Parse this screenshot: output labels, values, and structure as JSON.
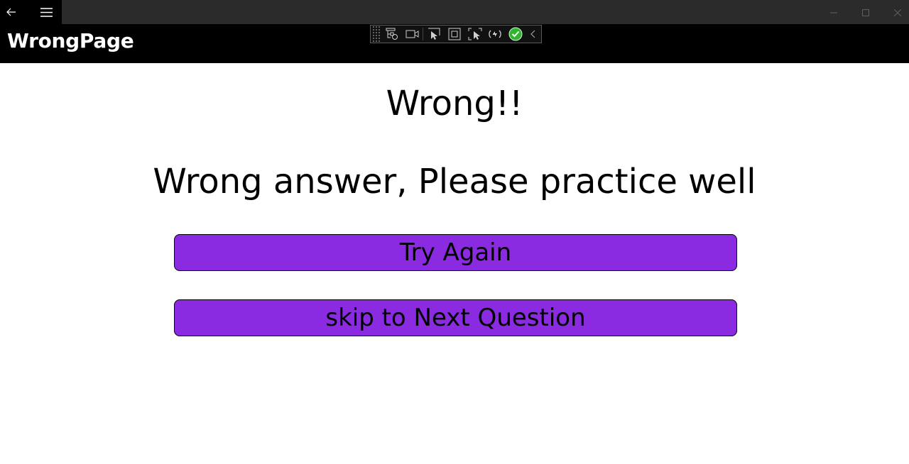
{
  "window": {
    "back_icon": "back-arrow-icon",
    "menu_icon": "hamburger-menu-icon",
    "minimize_icon": "minimize-icon",
    "maximize_icon": "maximize-icon",
    "close_icon": "close-icon"
  },
  "header": {
    "title": "WrongPage"
  },
  "debug_toolbar": {
    "icons": [
      "live-visual-tree-icon",
      "record-icon",
      "select-element-icon",
      "display-layout-adorners-icon",
      "track-focus-icon",
      "hot-reload-icon",
      "status-ok-icon",
      "collapse-chevron-icon"
    ]
  },
  "main": {
    "headline": "Wrong!!",
    "message": "Wrong answer, Please practice well",
    "try_again_label": "Try Again",
    "skip_label": "skip to Next Question"
  },
  "colors": {
    "button_fill": "#8a2be2",
    "header_background": "#000000",
    "titlebar_background": "#2b2b2b",
    "status_ok": "#2fb52f"
  }
}
